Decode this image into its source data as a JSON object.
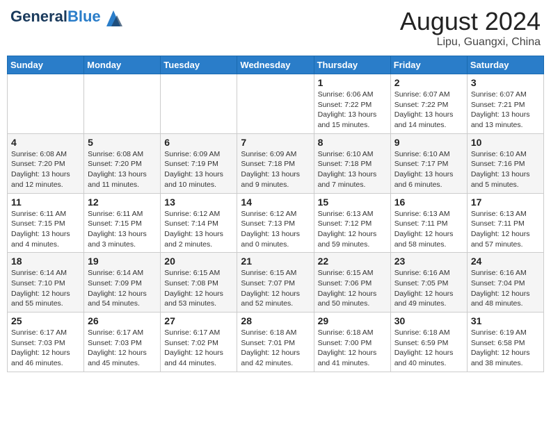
{
  "header": {
    "logo_line1": "General",
    "logo_line2": "Blue",
    "month_year": "August 2024",
    "location": "Lipu, Guangxi, China"
  },
  "weekdays": [
    "Sunday",
    "Monday",
    "Tuesday",
    "Wednesday",
    "Thursday",
    "Friday",
    "Saturday"
  ],
  "weeks": [
    [
      {
        "day": "",
        "info": ""
      },
      {
        "day": "",
        "info": ""
      },
      {
        "day": "",
        "info": ""
      },
      {
        "day": "",
        "info": ""
      },
      {
        "day": "1",
        "info": "Sunrise: 6:06 AM\nSunset: 7:22 PM\nDaylight: 13 hours\nand 15 minutes."
      },
      {
        "day": "2",
        "info": "Sunrise: 6:07 AM\nSunset: 7:22 PM\nDaylight: 13 hours\nand 14 minutes."
      },
      {
        "day": "3",
        "info": "Sunrise: 6:07 AM\nSunset: 7:21 PM\nDaylight: 13 hours\nand 13 minutes."
      }
    ],
    [
      {
        "day": "4",
        "info": "Sunrise: 6:08 AM\nSunset: 7:20 PM\nDaylight: 13 hours\nand 12 minutes."
      },
      {
        "day": "5",
        "info": "Sunrise: 6:08 AM\nSunset: 7:20 PM\nDaylight: 13 hours\nand 11 minutes."
      },
      {
        "day": "6",
        "info": "Sunrise: 6:09 AM\nSunset: 7:19 PM\nDaylight: 13 hours\nand 10 minutes."
      },
      {
        "day": "7",
        "info": "Sunrise: 6:09 AM\nSunset: 7:18 PM\nDaylight: 13 hours\nand 9 minutes."
      },
      {
        "day": "8",
        "info": "Sunrise: 6:10 AM\nSunset: 7:18 PM\nDaylight: 13 hours\nand 7 minutes."
      },
      {
        "day": "9",
        "info": "Sunrise: 6:10 AM\nSunset: 7:17 PM\nDaylight: 13 hours\nand 6 minutes."
      },
      {
        "day": "10",
        "info": "Sunrise: 6:10 AM\nSunset: 7:16 PM\nDaylight: 13 hours\nand 5 minutes."
      }
    ],
    [
      {
        "day": "11",
        "info": "Sunrise: 6:11 AM\nSunset: 7:15 PM\nDaylight: 13 hours\nand 4 minutes."
      },
      {
        "day": "12",
        "info": "Sunrise: 6:11 AM\nSunset: 7:15 PM\nDaylight: 13 hours\nand 3 minutes."
      },
      {
        "day": "13",
        "info": "Sunrise: 6:12 AM\nSunset: 7:14 PM\nDaylight: 13 hours\nand 2 minutes."
      },
      {
        "day": "14",
        "info": "Sunrise: 6:12 AM\nSunset: 7:13 PM\nDaylight: 13 hours\nand 0 minutes."
      },
      {
        "day": "15",
        "info": "Sunrise: 6:13 AM\nSunset: 7:12 PM\nDaylight: 12 hours\nand 59 minutes."
      },
      {
        "day": "16",
        "info": "Sunrise: 6:13 AM\nSunset: 7:11 PM\nDaylight: 12 hours\nand 58 minutes."
      },
      {
        "day": "17",
        "info": "Sunrise: 6:13 AM\nSunset: 7:11 PM\nDaylight: 12 hours\nand 57 minutes."
      }
    ],
    [
      {
        "day": "18",
        "info": "Sunrise: 6:14 AM\nSunset: 7:10 PM\nDaylight: 12 hours\nand 55 minutes."
      },
      {
        "day": "19",
        "info": "Sunrise: 6:14 AM\nSunset: 7:09 PM\nDaylight: 12 hours\nand 54 minutes."
      },
      {
        "day": "20",
        "info": "Sunrise: 6:15 AM\nSunset: 7:08 PM\nDaylight: 12 hours\nand 53 minutes."
      },
      {
        "day": "21",
        "info": "Sunrise: 6:15 AM\nSunset: 7:07 PM\nDaylight: 12 hours\nand 52 minutes."
      },
      {
        "day": "22",
        "info": "Sunrise: 6:15 AM\nSunset: 7:06 PM\nDaylight: 12 hours\nand 50 minutes."
      },
      {
        "day": "23",
        "info": "Sunrise: 6:16 AM\nSunset: 7:05 PM\nDaylight: 12 hours\nand 49 minutes."
      },
      {
        "day": "24",
        "info": "Sunrise: 6:16 AM\nSunset: 7:04 PM\nDaylight: 12 hours\nand 48 minutes."
      }
    ],
    [
      {
        "day": "25",
        "info": "Sunrise: 6:17 AM\nSunset: 7:03 PM\nDaylight: 12 hours\nand 46 minutes."
      },
      {
        "day": "26",
        "info": "Sunrise: 6:17 AM\nSunset: 7:03 PM\nDaylight: 12 hours\nand 45 minutes."
      },
      {
        "day": "27",
        "info": "Sunrise: 6:17 AM\nSunset: 7:02 PM\nDaylight: 12 hours\nand 44 minutes."
      },
      {
        "day": "28",
        "info": "Sunrise: 6:18 AM\nSunset: 7:01 PM\nDaylight: 12 hours\nand 42 minutes."
      },
      {
        "day": "29",
        "info": "Sunrise: 6:18 AM\nSunset: 7:00 PM\nDaylight: 12 hours\nand 41 minutes."
      },
      {
        "day": "30",
        "info": "Sunrise: 6:18 AM\nSunset: 6:59 PM\nDaylight: 12 hours\nand 40 minutes."
      },
      {
        "day": "31",
        "info": "Sunrise: 6:19 AM\nSunset: 6:58 PM\nDaylight: 12 hours\nand 38 minutes."
      }
    ]
  ]
}
